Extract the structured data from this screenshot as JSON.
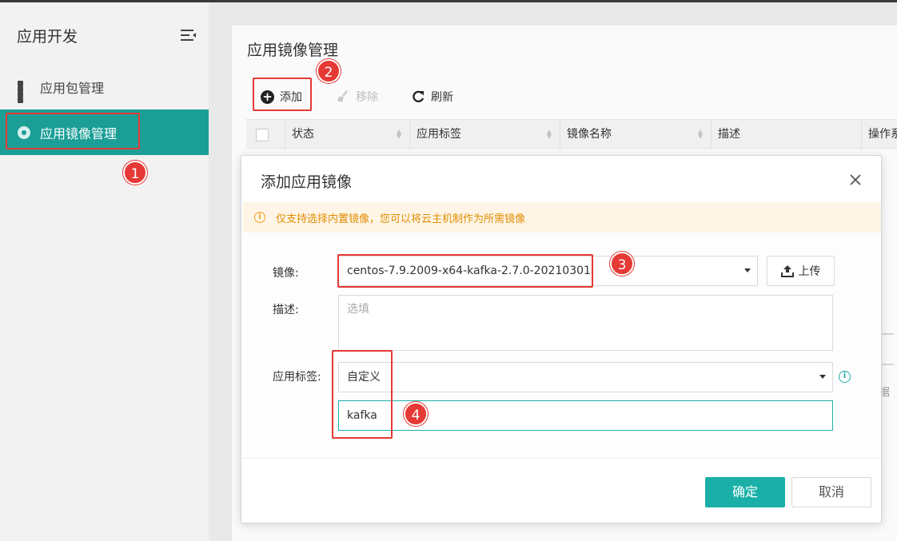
{
  "sidebar": {
    "title": "应用开发",
    "items": [
      {
        "label": "应用包管理",
        "icon": "grid-icon"
      },
      {
        "label": "应用镜像管理",
        "icon": "disc-icon",
        "active": true
      }
    ]
  },
  "main": {
    "title": "应用镜像管理",
    "toolbar": {
      "add_label": "添加",
      "remove_label": "移除",
      "refresh_label": "刷新"
    },
    "table": {
      "columns": [
        "状态",
        "应用标签",
        "镜像名称",
        "描述",
        "操作系"
      ]
    },
    "empty_text": "据"
  },
  "dialog": {
    "title": "添加应用镜像",
    "alert": "仅支持选择内置镜像，您可以将云主机制作为所需镜像",
    "fields": {
      "image_label": "镜像:",
      "image_value": "centos-7.9.2009-x64-kafka-2.7.0-20210301",
      "upload_label": "上传",
      "desc_label": "描述:",
      "desc_placeholder": "选填",
      "tag_label": "应用标签:",
      "tag_select_value": "自定义",
      "tag_input_value": "kafka"
    },
    "ok_label": "确定",
    "cancel_label": "取消"
  },
  "annotations": [
    "1",
    "2",
    "3",
    "4"
  ],
  "colors": {
    "accent": "#1ab0a8",
    "sidebar_active": "#1a9e96",
    "annotation": "#e53935",
    "alert_text": "#e08d00"
  }
}
